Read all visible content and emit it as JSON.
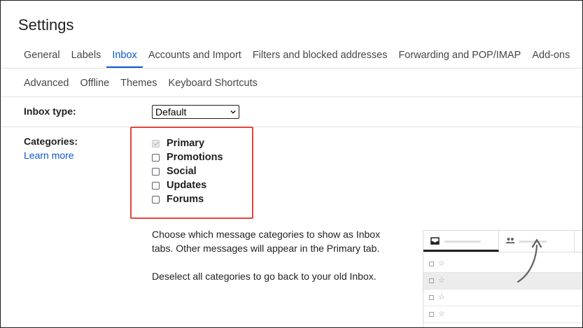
{
  "page": {
    "title": "Settings"
  },
  "tabs_row1": [
    {
      "label": "General",
      "active": false
    },
    {
      "label": "Labels",
      "active": false
    },
    {
      "label": "Inbox",
      "active": true
    },
    {
      "label": "Accounts and Import",
      "active": false
    },
    {
      "label": "Filters and blocked addresses",
      "active": false
    },
    {
      "label": "Forwarding and POP/IMAP",
      "active": false
    },
    {
      "label": "Add-ons",
      "active": false
    }
  ],
  "tabs_row2": [
    {
      "label": "Advanced"
    },
    {
      "label": "Offline"
    },
    {
      "label": "Themes"
    },
    {
      "label": "Keyboard Shortcuts"
    }
  ],
  "inbox_type": {
    "label": "Inbox type:",
    "selected": "Default"
  },
  "categories": {
    "label": "Categories:",
    "learn_more": "Learn more",
    "items": [
      {
        "label": "Primary",
        "checked": true,
        "disabled": true
      },
      {
        "label": "Promotions",
        "checked": false,
        "disabled": false
      },
      {
        "label": "Social",
        "checked": false,
        "disabled": false
      },
      {
        "label": "Updates",
        "checked": false,
        "disabled": false
      },
      {
        "label": "Forums",
        "checked": false,
        "disabled": false
      }
    ],
    "description_line1": "Choose which message categories to show as Inbox",
    "description_line2": "tabs. Other messages will appear in the Primary tab.",
    "deselect_note": "Deselect all categories to go back to your old Inbox."
  },
  "preview": {
    "tab_icons": [
      "inbox-icon",
      "people-icon"
    ],
    "star_glyph": "☆"
  },
  "colors": {
    "accent": "#0b57d0",
    "highlight_box": "#e4453a"
  }
}
